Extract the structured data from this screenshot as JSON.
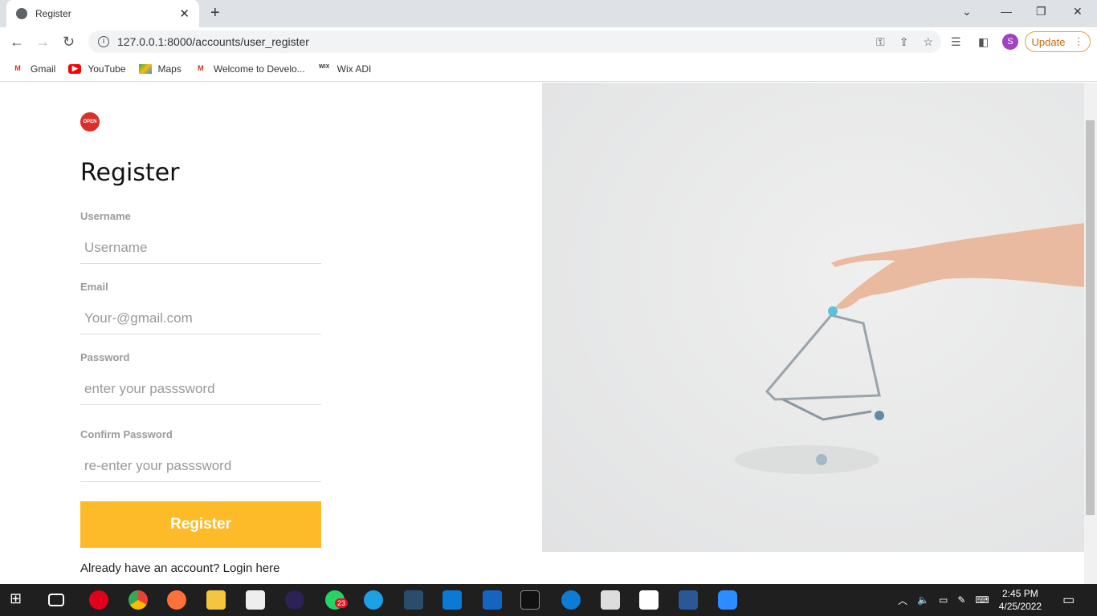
{
  "browser": {
    "tab_title": "Register",
    "url": "127.0.0.1:8000/accounts/user_register",
    "profile_initial": "S",
    "update_label": "Update",
    "bookmarks": [
      {
        "label": "Gmail",
        "icon": "gmail-icon"
      },
      {
        "label": "YouTube",
        "icon": "youtube-icon"
      },
      {
        "label": "Maps",
        "icon": "maps-icon"
      },
      {
        "label": "Welcome to Develo...",
        "icon": "gmail-icon"
      },
      {
        "label": "Wix ADI",
        "icon": "wix-icon"
      }
    ]
  },
  "page": {
    "logo_text": "OPEN",
    "title": "Register",
    "fields": [
      {
        "label": "Username",
        "placeholder": "Username"
      },
      {
        "label": "Email",
        "placeholder": "Your-@gmail.com"
      },
      {
        "label": "Password",
        "placeholder": "enter your passsword"
      },
      {
        "label": "Confirm Password",
        "placeholder": "re-enter your passsword"
      }
    ],
    "submit_label": "Register",
    "login_prompt": "Already have an account? Login here",
    "accent_color": "#fdbb2a"
  },
  "taskbar": {
    "time": "2:45 PM",
    "date": "4/25/2022",
    "whatsapp_badge": "23"
  }
}
